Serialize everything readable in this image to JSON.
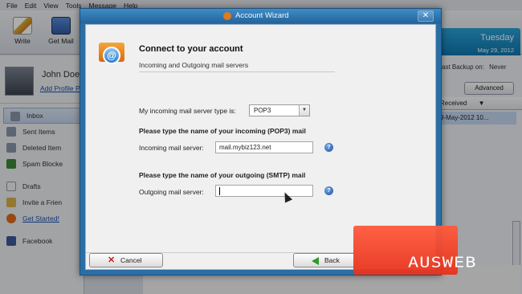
{
  "menubar": {
    "items": [
      "File",
      "Edit",
      "View",
      "Tools",
      "Message",
      "Help"
    ]
  },
  "toolbar": {
    "write_label": "Write",
    "getmail_label": "Get Mail",
    "date_day": "Tuesday",
    "date_full": "May 29, 2012"
  },
  "sidebar": {
    "profile_name": "John Doe",
    "profile_link": "Add Profile P",
    "items": [
      {
        "label": "Inbox",
        "icon": "inbox-icon"
      },
      {
        "label": "Sent Items",
        "icon": "sent-items-icon"
      },
      {
        "label": "Deleted Item",
        "icon": "trash-icon"
      },
      {
        "label": "Spam Blocke",
        "icon": "spam-icon"
      },
      {
        "label": "Drafts",
        "icon": "drafts-icon"
      },
      {
        "label": "Invite a Frien",
        "icon": "invite-icon"
      },
      {
        "label": "Get Started!",
        "icon": "get-started-icon"
      },
      {
        "label": "Facebook",
        "icon": "facebook-icon"
      }
    ]
  },
  "rightpanel": {
    "backup_label": "ast Backup on:",
    "backup_value": "Never",
    "advanced_label": "Advanced",
    "col_received": "Received",
    "row_date": "9-May-2012 10..."
  },
  "dialog": {
    "title": "Account Wizard",
    "close_symbol": "✕",
    "heading": "Connect to your account",
    "subheading": "Incoming and Outgoing mail servers",
    "incoming_type_label": "My incoming mail server type is:",
    "incoming_type_value": "POP3",
    "incoming_section_label": "Please type the name of your incoming (POP3) mail",
    "incoming_server_label": "Incoming mail server:",
    "incoming_server_value": "mail.mybiz123.net",
    "outgoing_section_label": "Please type the name of your outgoing (SMTP) mail",
    "outgoing_server_label": "Outgoing mail server:",
    "outgoing_server_value": "",
    "help_symbol": "?",
    "cancel_label": "Cancel",
    "back_label": "Back"
  },
  "watermark": {
    "text": "AUSWEB"
  },
  "colors": {
    "dialog_title": "#2b6ea4",
    "date_box": "#1a88c4",
    "logo_red": "#f0442a"
  }
}
